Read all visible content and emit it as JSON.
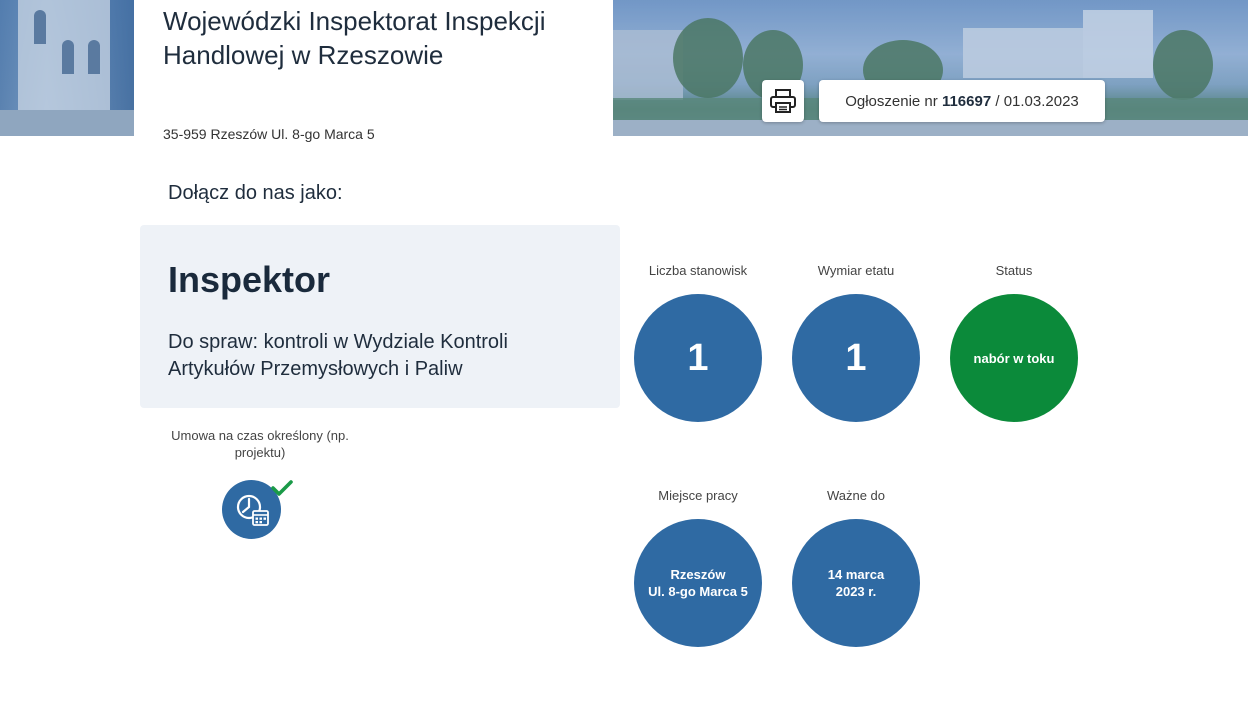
{
  "organization": {
    "name": "Wojewódzki Inspektorat Inspekcji Handlowej w Rzeszowie",
    "address": "35-959 Rzeszów Ul. 8-go Marca 5"
  },
  "announcement": {
    "prefix": "Ogłoszenie nr",
    "number": "116697",
    "separator": "/",
    "date": "01.03.2023"
  },
  "print_icon": "printer-icon",
  "join_label": "Dołącz do nas jako:",
  "job": {
    "title": "Inspektor",
    "description": "Do spraw: kontroli w Wydziale Kontroli Artykułów Przemysłowych i Paliw"
  },
  "contract": {
    "label": "Umowa na czas określony (np. projektu)",
    "icon": "contract-calendar-icon",
    "checked_icon": "checkmark-icon"
  },
  "stats": {
    "positions": {
      "label": "Liczba stanowisk",
      "value": "1"
    },
    "fte": {
      "label": "Wymiar etatu",
      "value": "1"
    },
    "status": {
      "label": "Status",
      "value": "nabór w toku"
    },
    "location": {
      "label": "Miejsce pracy",
      "line1": "Rzeszów",
      "line2": "Ul. 8-go Marca 5"
    },
    "valid_until": {
      "label": "Ważne do",
      "line1": "14 marca",
      "line2": "2023 r."
    }
  },
  "colors": {
    "circle_blue": "#2f6aa3",
    "status_green": "#0b8a3a",
    "card_bg": "#eef2f7",
    "check_green": "#1a9a48"
  }
}
